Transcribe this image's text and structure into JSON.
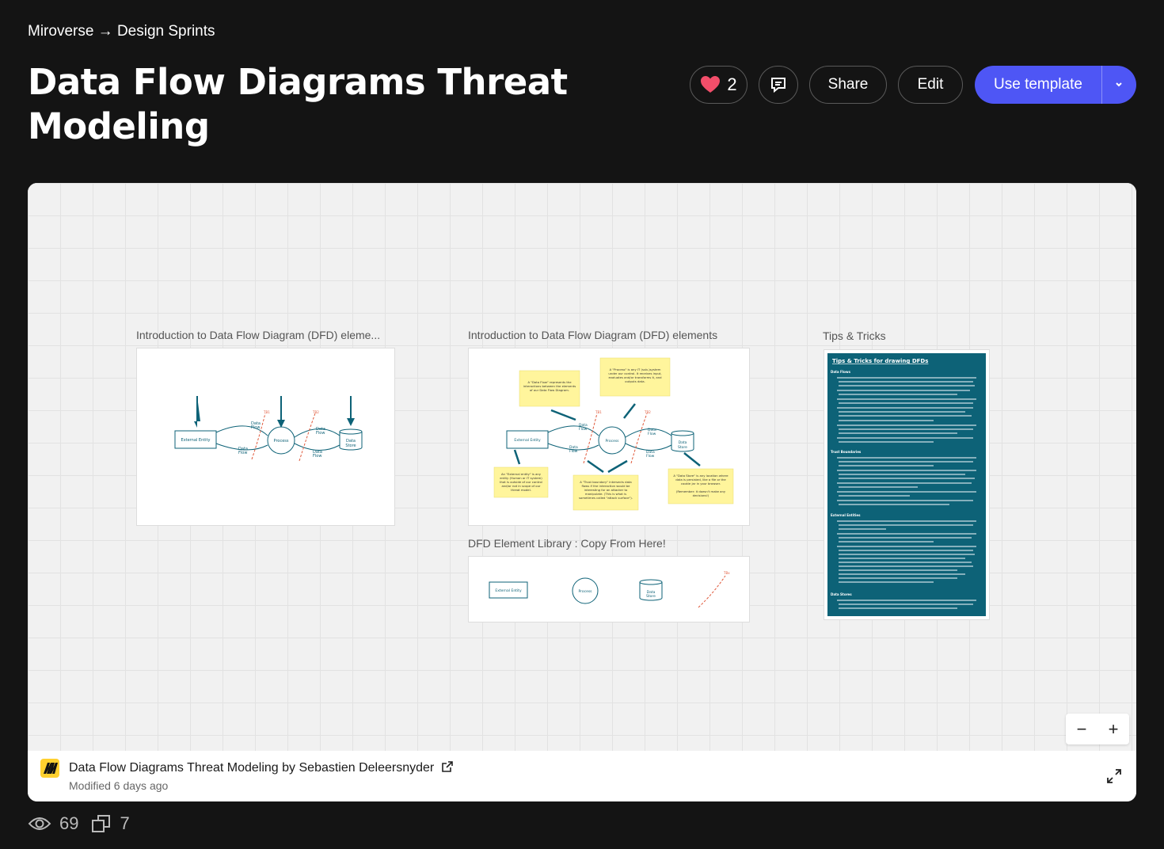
{
  "breadcrumb": "Miroverse → Design Sprints",
  "title": "Data Flow Diagrams Threat Modeling",
  "actions": {
    "likes": "2",
    "share": "Share",
    "edit": "Edit",
    "use_template": "Use template"
  },
  "board": {
    "frames": [
      {
        "label": "Introduction to Data Flow Diagram (DFD) eleme..."
      },
      {
        "label": "Introduction to Data Flow Diagram (DFD) elements"
      },
      {
        "label": "DFD Element Library : Copy From Here!"
      },
      {
        "label": "Tips & Tricks"
      }
    ],
    "zoom_out": "−",
    "zoom_in": "+"
  },
  "diagram_labels": {
    "external_entity": "External Entity",
    "process": "Process",
    "data_store": "Data Store",
    "data_flow": "Data Flow",
    "tb": "TB1"
  },
  "tips": {
    "heading": "Tips & Tricks for drawing DFDs",
    "sections": [
      "Data Flows",
      "Trust Boundaries",
      "External Entities",
      "Data Stores"
    ]
  },
  "footer": {
    "title": "Data Flow Diagrams Threat Modeling by Sebastien Deleersnyder",
    "modified": "Modified 6 days ago"
  },
  "stats": {
    "views": "69",
    "copies": "7"
  },
  "colors": {
    "accent": "#4e56f5",
    "background": "#141414",
    "heart": "#f24e6a",
    "diagram_teal": "#0d6277",
    "sticky": "#fff59c",
    "miro_yellow": "#ffd02f"
  }
}
